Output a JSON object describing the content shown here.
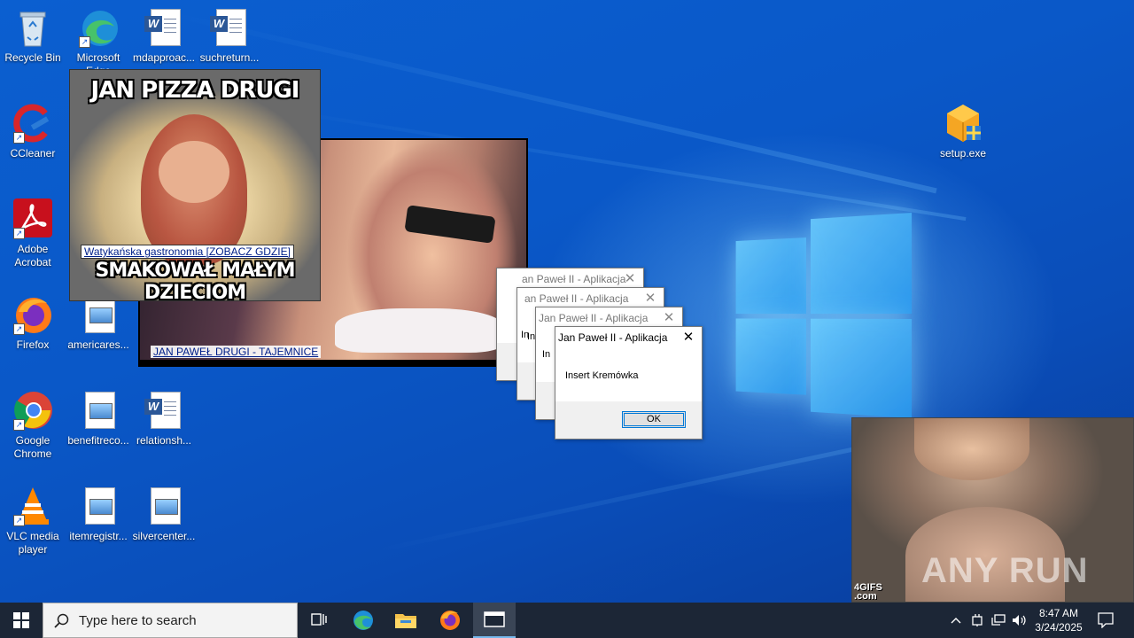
{
  "desktop_icons": [
    {
      "name": "recycle-bin",
      "label": "Recycle Bin"
    },
    {
      "name": "microsoft-edge",
      "label": "Microsoft Edge"
    },
    {
      "name": "mdapproach",
      "label": "mdapproac..."
    },
    {
      "name": "suchreturn",
      "label": "suchreturn..."
    },
    {
      "name": "ccleaner",
      "label": "CCleaner"
    },
    {
      "name": "adobe-acrobat",
      "label": "Adobe Acrobat"
    },
    {
      "name": "firefox",
      "label": "Firefox"
    },
    {
      "name": "americares",
      "label": "americares..."
    },
    {
      "name": "google-chrome",
      "label": "Google Chrome"
    },
    {
      "name": "benefitreco",
      "label": "benefitreco..."
    },
    {
      "name": "relationsh",
      "label": "relationsh..."
    },
    {
      "name": "vlc",
      "label": "VLC media player"
    },
    {
      "name": "itemregistr",
      "label": "itemregistr..."
    },
    {
      "name": "silvercenter",
      "label": "silvercenter..."
    },
    {
      "name": "setup-exe",
      "label": "setup.exe"
    }
  ],
  "popups": {
    "pizza": {
      "title": "JAN PIZZA DRUGI",
      "caption": "Watykańska gastronomia [ZOBACZ GDZIE]",
      "bottom": "SMAKOWAŁ MAŁYM DZIECIOM"
    },
    "video": {
      "caption": "JAN PAWEŁ DRUGI - TAJEMNICE"
    },
    "gif": {
      "watermark_4gifs": "4GIFS\n.com",
      "watermark_anyrun": "ANY RUN"
    }
  },
  "dialogs": {
    "title": "Jan Paweł II - Aplikacja",
    "back_titles": [
      "an Paweł II - Aplikacja",
      "an Paweł II - Aplikacja",
      "Jan Paweł II - Aplikacja"
    ],
    "message": "Insert Kremówka",
    "ok": "OK",
    "partial": "In"
  },
  "taskbar": {
    "search_placeholder": "Type here to search",
    "time": "8:47 AM",
    "date": "3/24/2025"
  },
  "colors": {
    "desktop": "#0a58c8",
    "taskbar": "#1c2636",
    "accent": "#0078d7"
  }
}
